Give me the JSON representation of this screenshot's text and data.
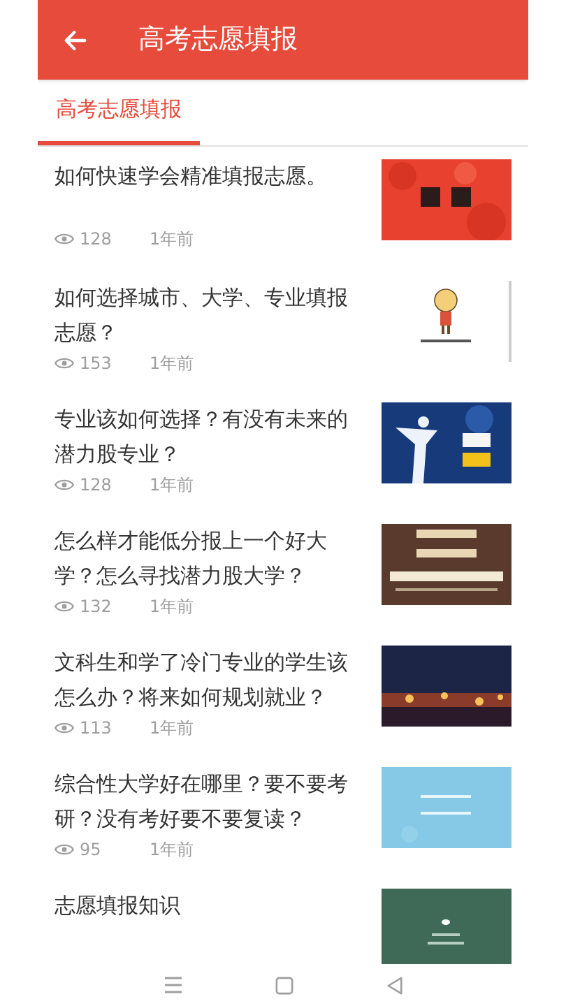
{
  "app_bar": {
    "title": "高考志愿填报"
  },
  "tabs": [
    {
      "label": "高考志愿填报",
      "selected": true
    }
  ],
  "articles": [
    {
      "title": "如何快速学会精准填报志愿。",
      "views": "128",
      "time": "1年前"
    },
    {
      "title": "如何选择城市、大学、专业填报志愿？",
      "views": "153",
      "time": "1年前"
    },
    {
      "title": "专业该如何选择？有没有未来的潜力股专业？",
      "views": "128",
      "time": "1年前"
    },
    {
      "title": "怎么样才能低分报上一个好大学？怎么寻找潜力股大学？",
      "views": "132",
      "time": "1年前"
    },
    {
      "title": "文科生和学了冷门专业的学生该怎么办？将来如何规划就业？",
      "views": "113",
      "time": "1年前"
    },
    {
      "title": "综合性大学好在哪里？要不要考研？没有考好要不要复读？",
      "views": "95",
      "time": "1年前"
    },
    {
      "title": "志愿填报知识"
    }
  ]
}
